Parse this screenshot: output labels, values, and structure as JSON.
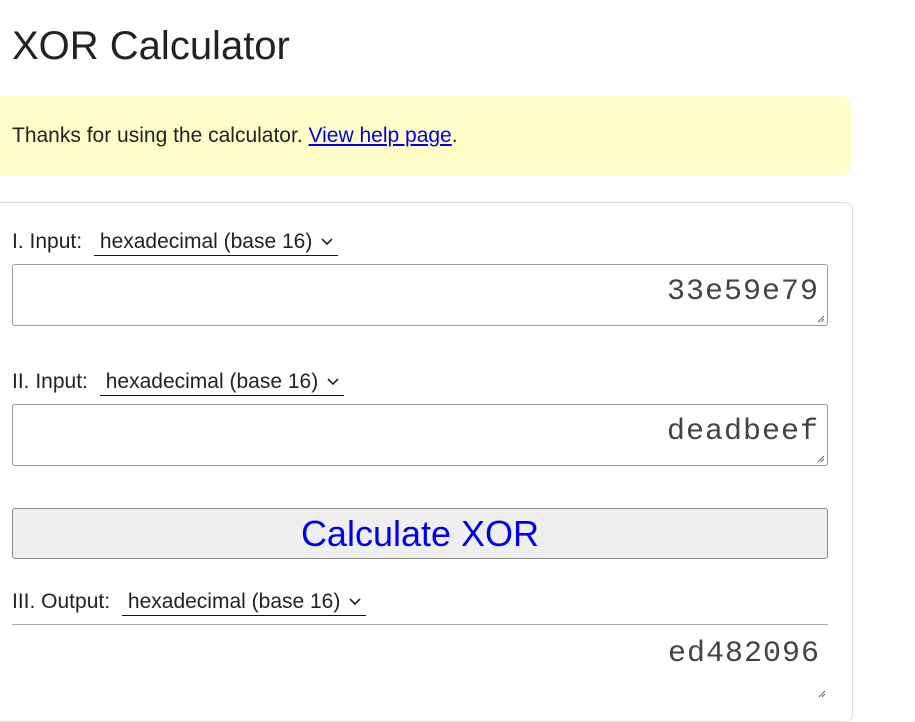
{
  "page": {
    "title": "XOR Calculator"
  },
  "notice": {
    "text": "Thanks for using the calculator. ",
    "link_text": "View help page",
    "suffix": "."
  },
  "input1": {
    "label": "I. Input:",
    "base": "hexadecimal (base 16)",
    "value": "33e59e79"
  },
  "input2": {
    "label": "II. Input:",
    "base": "hexadecimal (base 16)",
    "value": "deadbeef"
  },
  "calculate": {
    "label": "Calculate XOR"
  },
  "output": {
    "label": "III. Output:",
    "base": "hexadecimal (base 16)",
    "value": "ed482096"
  },
  "colors": {
    "link": "#0000ee",
    "banner_bg": "#ffffc9",
    "button_bg": "#efefef"
  }
}
